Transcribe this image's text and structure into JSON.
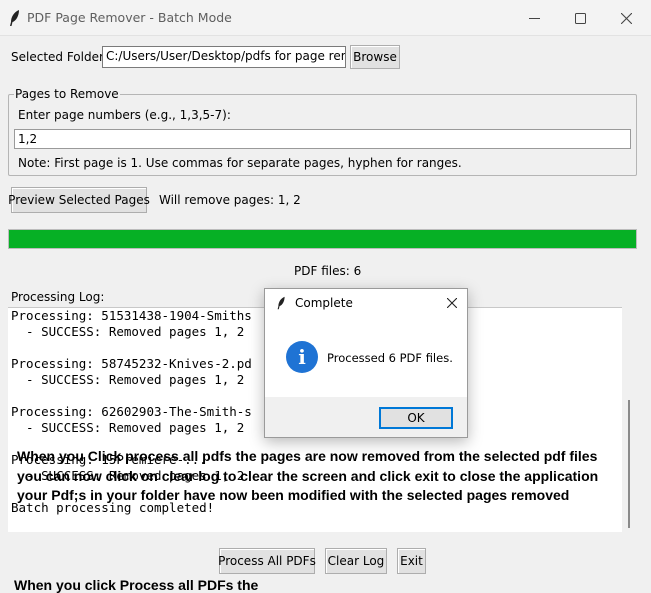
{
  "window": {
    "title": "PDF Page Remover - Batch Mode"
  },
  "folder": {
    "label": "Selected Folder:",
    "path": "C:/Users/User/Desktop/pdfs for page removal",
    "browse_label": "Browse"
  },
  "pages": {
    "frame_title": "Pages to Remove",
    "prompt": "Enter page numbers (e.g., 1,3,5-7):",
    "value": "1,2",
    "note": "Note: First page is 1. Use commas for separate pages, hyphen for ranges."
  },
  "preview": {
    "button_label": "Preview Selected Pages",
    "status": "Will remove pages: 1, 2"
  },
  "progress": {
    "fraction": 1.0,
    "color": "#06b025"
  },
  "file_count": "PDF files: 6",
  "log": {
    "label": "Processing Log:",
    "lines": [
      "Processing: 51531438-1904-Smiths",
      "  - SUCCESS: Removed pages 1, 2",
      "",
      "Processing: 58745232-Knives-2.pd",
      "  - SUCCESS: Removed pages 1, 2",
      "",
      "Processing: 62602903-The-Smith-s",
      "  - SUCCESS: Removed pages 1, 2",
      "",
      "Processing: 15Premiere-...",
      "  - SUCCESS: Removed pages 1, 2",
      "",
      "Batch processing completed!"
    ]
  },
  "overlay_text": [
    "When you Click process all pdfs the pages are now removed from the selected pdf files",
    "you can now click on clear log to clear the screen and click exit to close the application",
    "your Pdf;s in your folder have now been modified with the selected pages removed"
  ],
  "overlay_text_bottom": "When you click Process all PDFs the",
  "buttons": {
    "process_all": "Process All PDFs",
    "clear_log": "Clear Log",
    "exit": "Exit"
  },
  "dialog": {
    "title": "Complete",
    "message": "Processed 6 PDF files.",
    "ok_label": "OK",
    "icon": "info-icon",
    "icon_color": "#1f73d4"
  }
}
